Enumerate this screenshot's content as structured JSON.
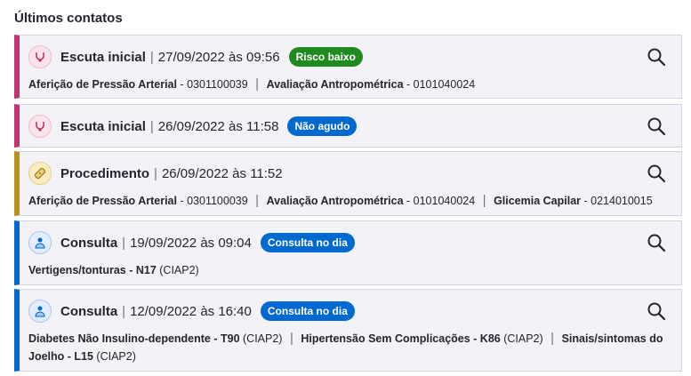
{
  "section_title": "Últimos contatos",
  "colors": {
    "escuta": "#c4326f",
    "procedimento": "#b8921f",
    "consulta": "#0069d0",
    "badge_green": "#1f8a1f",
    "badge_blue": "#0069d0"
  },
  "contacts": [
    {
      "type": "Escuta inicial",
      "datetime": "27/09/2022 às 09:56",
      "badge": "Risco baixo",
      "icon": "stethoscope-icon",
      "details": [
        {
          "name": "Aferição de Pressão Arterial",
          "code": " - 0301100039"
        },
        {
          "name": "Avaliação Antropométrica",
          "code": " - 0101040024"
        }
      ]
    },
    {
      "type": "Escuta inicial",
      "datetime": "26/09/2022 às 11:58",
      "badge": "Não agudo",
      "icon": "stethoscope-icon",
      "details": []
    },
    {
      "type": "Procedimento",
      "datetime": "26/09/2022 às 11:52",
      "badge": "",
      "icon": "bandage-icon",
      "details": [
        {
          "name": "Aferição de Pressão Arterial",
          "code": " - 0301100039"
        },
        {
          "name": "Avaliação Antropométrica",
          "code": " - 0101040024"
        },
        {
          "name": "Glicemia Capilar",
          "code": " - 0214010015"
        }
      ]
    },
    {
      "type": "Consulta",
      "datetime": "19/09/2022 às 09:04",
      "badge": "Consulta no dia",
      "icon": "doctor-icon",
      "details": [
        {
          "name": "Vertigens/tonturas - N17",
          "code": " (CIAP2)"
        }
      ]
    },
    {
      "type": "Consulta",
      "datetime": "12/09/2022 às 16:40",
      "badge": "Consulta no dia",
      "icon": "doctor-icon",
      "details": [
        {
          "name": "Diabetes Não Insulino-dependente - T90",
          "code": " (CIAP2)"
        },
        {
          "name": "Hipertensão Sem Complicações - K86",
          "code": " (CIAP2)"
        },
        {
          "name": "Sinais/sintomas do Joelho - L15",
          "code": " (CIAP2)"
        }
      ]
    }
  ],
  "separator": "|"
}
